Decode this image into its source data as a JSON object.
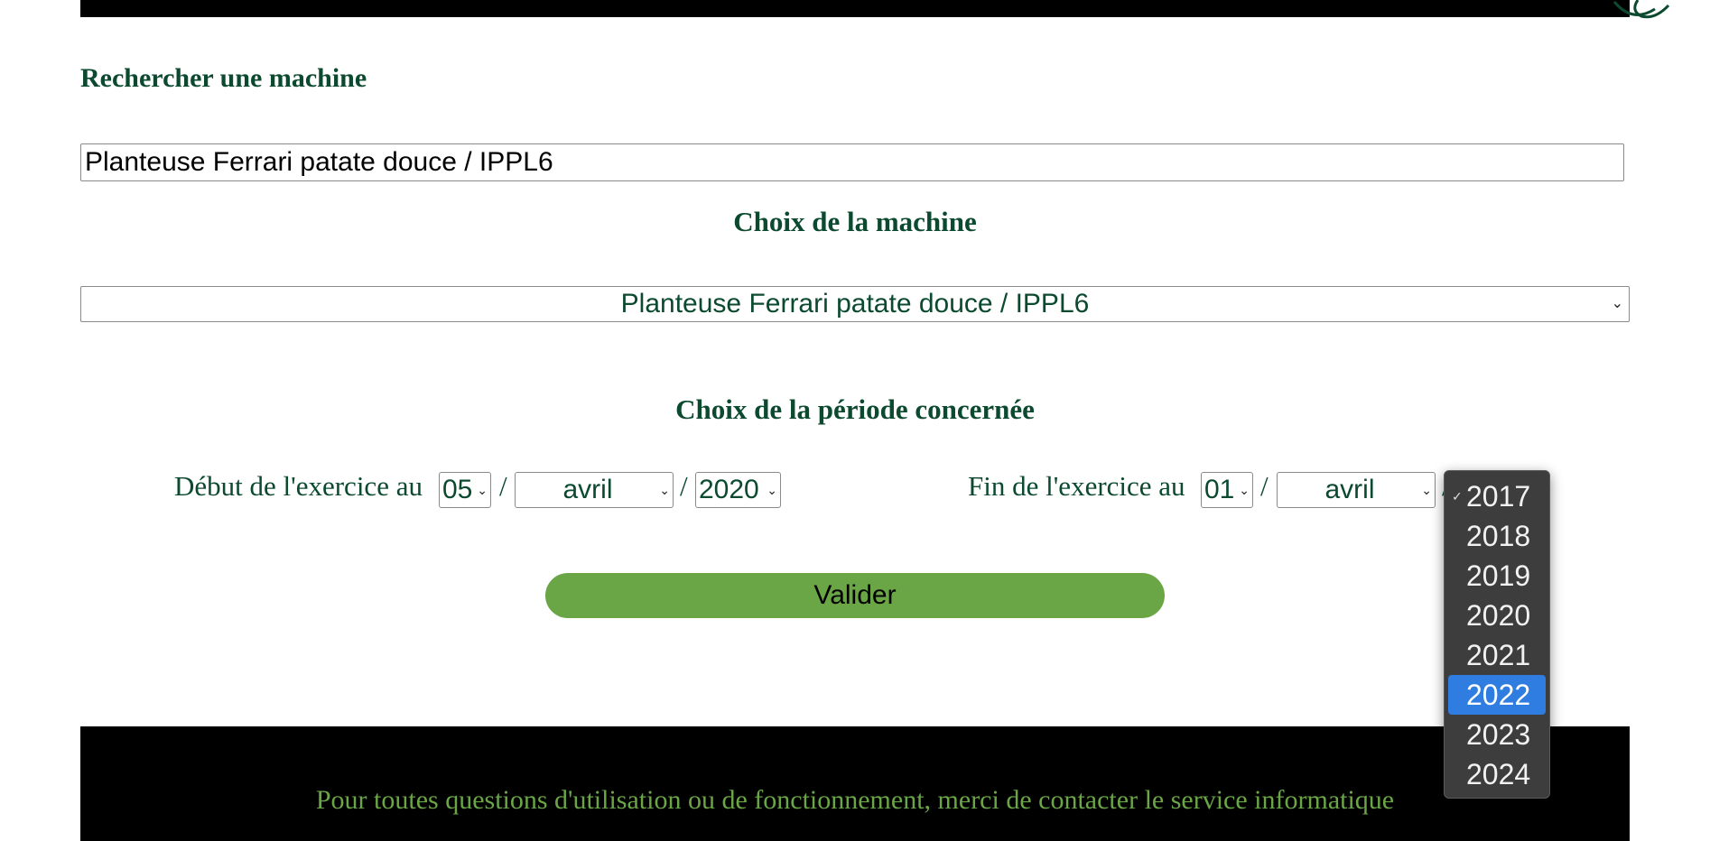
{
  "header": {
    "bar_color": "#000000"
  },
  "search": {
    "title": "Rechercher une machine",
    "value": "Planteuse Ferrari patate douce / IPPL6"
  },
  "machine": {
    "title": "Choix de la machine",
    "selected": "Planteuse Ferrari patate douce / IPPL6"
  },
  "period": {
    "title": "Choix de la période concernée",
    "start": {
      "label": "Début de l'exercice au",
      "day": "05",
      "month": "avril",
      "year": "2020"
    },
    "end": {
      "label": "Fin de l'exercice au",
      "day": "01",
      "month": "avril"
    },
    "separator": "/"
  },
  "validate": {
    "label": "Valider"
  },
  "footer": {
    "text": "Pour toutes questions d'utilisation ou de fonctionnement, merci de contacter le service informatique"
  },
  "year_dropdown": {
    "checked": "2017",
    "highlighted": "2022",
    "options": [
      "2017",
      "2018",
      "2019",
      "2020",
      "2021",
      "2022",
      "2023",
      "2024"
    ]
  },
  "colors": {
    "title_green": "#0b4a2f",
    "button_green": "#6aa646",
    "highlight_blue": "#2f7de1",
    "dropdown_bg": "#3d3d3d"
  },
  "icons": {
    "chevron": "chevron-down-icon",
    "check": "checkmark-icon"
  }
}
